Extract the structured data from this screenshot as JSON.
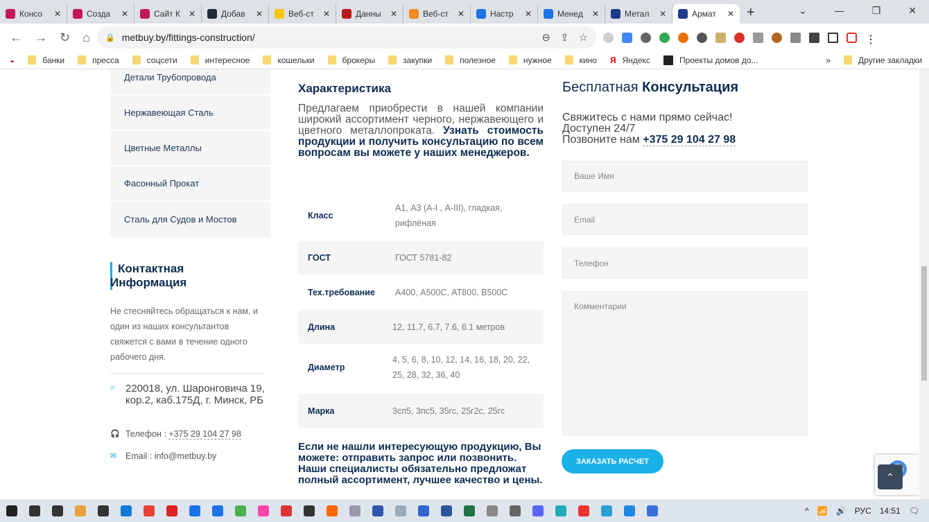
{
  "browser": {
    "tabs": [
      {
        "title": "Консо",
        "color": "#c2185b"
      },
      {
        "title": "Созда",
        "color": "#c2185b"
      },
      {
        "title": "Сайт К",
        "color": "#c2185b"
      },
      {
        "title": "Добав",
        "color": "#1f2b3a"
      },
      {
        "title": "Веб-ст",
        "color": "#f6c700"
      },
      {
        "title": "Данны",
        "color": "#b71c1c"
      },
      {
        "title": "Веб-ст",
        "color": "#f28b20"
      },
      {
        "title": "Настр",
        "color": "#1a73e8"
      },
      {
        "title": "Менед",
        "color": "#1a73e8"
      },
      {
        "title": "Метал",
        "color": "#1e3a8a"
      },
      {
        "title": "Армат",
        "color": "#1e3a8a",
        "active": true
      }
    ],
    "url": "metbuy.by/fittings-construction/",
    "bookmarks": [
      "банки",
      "пресса",
      "соцсети",
      "интересное",
      "кошельки",
      "брокеры",
      "закупки",
      "полезное",
      "нужное",
      "кино"
    ],
    "yandex": "Яндекс",
    "projects": "Проекты домов до...",
    "other_bookmarks": "Другие закладки"
  },
  "sidebar": {
    "items": [
      "Детали Трубопровода",
      "Нержавеющая Сталь",
      "Цветные Металлы",
      "Фасонный Прокат",
      "Сталь для Судов и Мостов"
    ],
    "contact_title_1": "Контактная",
    "contact_title_2": "Информация",
    "contact_text": "Не стесняйтесь обращаться к нам, и один из наших консультантов свяжется с вами в течение одного рабочего дня.",
    "address": "220018, ул. Шаронговича 19, кор.2, каб.175Д, г. Минск, РБ",
    "phone_label": "Телефон :",
    "phone": "+375 29 104 27 98",
    "email_label": "Email :",
    "email": "info@metbuy.by"
  },
  "main": {
    "title": "Характеристика",
    "intro_plain": "Предлагаем приобрести в нашей компании широкий ассортимент черного, нержавеющего и цветного металлопроката.",
    "intro_bold": "Узнать стоимость продукции и получить консультацию по всем вопросам вы можете у наших менеджеров.",
    "specs": [
      {
        "k": "Класс",
        "v": "А1, А3 (А-I , А-III), гладкая, рифлёная"
      },
      {
        "k": "ГОСТ",
        "v": "ГОСТ 5781-82"
      },
      {
        "k": "Тех.требование",
        "v": "А400, А500С, АТ800, В500С"
      },
      {
        "k": "Длина",
        "v": "12, 11.7, 6.7, 7.6, 6.1 метров"
      },
      {
        "k": "Диаметр",
        "v": "4, 5, 6, 8, 10, 12, 14, 16, 18, 20, 22, 25, 28, 32, 36, 40"
      },
      {
        "k": "Марка",
        "v": "3сп5, 3пс5, 35гс, 25г2с, 25гс"
      }
    ],
    "outro": "Если не нашли интересующую продукцию, Вы можете: отправить запрос или позвонить. Наши специалисты обязательно предложат полный ассортимент, лучшее качество и цены."
  },
  "consult": {
    "title_plain": "Бесплатная",
    "title_bold": "Консультация",
    "line1": "Свяжитесь с нами прямо сейчас!",
    "line2": "Доступен 24/7",
    "line3": "Позвоните нам",
    "phone": "+375 29 104 27 98",
    "name_ph": "Ваше Имя",
    "email_ph": "Email",
    "phone_ph": "Телефон",
    "comment_ph": "Комментарии",
    "submit": "ЗАКАЗАТЬ РАСЧЕТ"
  },
  "taskbar": {
    "lang": "РУС",
    "time": "14:51"
  }
}
